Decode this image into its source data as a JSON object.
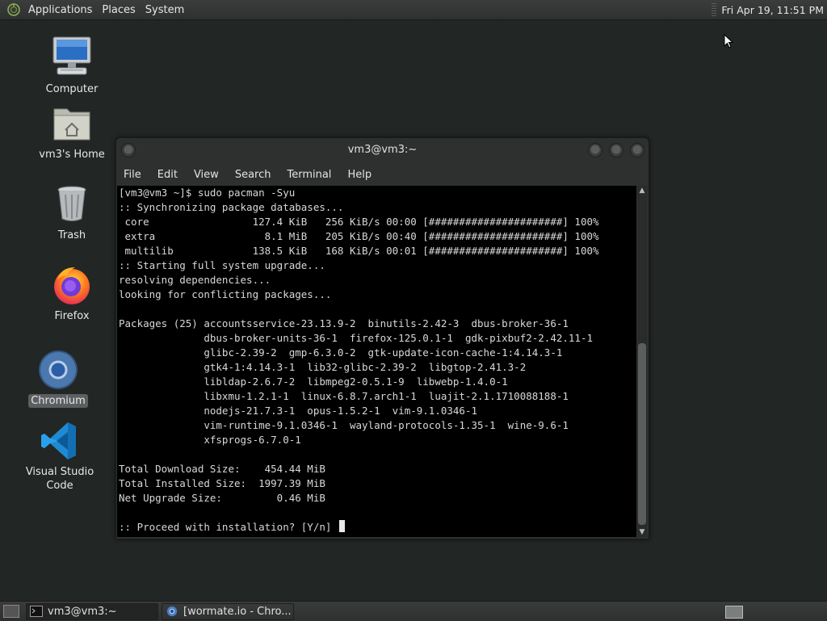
{
  "top_panel": {
    "menus": [
      "Applications",
      "Places",
      "System"
    ],
    "clock": "Fri Apr 19, 11:51 PM"
  },
  "desktop": {
    "icons": [
      {
        "label": "Computer",
        "icon": "computer-icon"
      },
      {
        "label": "vm3's Home",
        "icon": "home-folder-icon"
      },
      {
        "label": "Trash",
        "icon": "trash-icon"
      },
      {
        "label": "Firefox",
        "icon": "firefox-icon"
      },
      {
        "label": "Chromium",
        "icon": "chromium-icon",
        "selected": true
      },
      {
        "label": "Visual Studio Code",
        "icon": "vscode-icon"
      }
    ]
  },
  "terminal": {
    "title": "vm3@vm3:~",
    "menu": [
      "File",
      "Edit",
      "View",
      "Search",
      "Terminal",
      "Help"
    ],
    "lines": [
      "[vm3@vm3 ~]$ sudo pacman -Syu",
      ":: Synchronizing package databases...",
      " core                 127.4 KiB   256 KiB/s 00:00 [######################] 100%",
      " extra                  8.1 MiB   205 KiB/s 00:40 [######################] 100%",
      " multilib             138.5 KiB   168 KiB/s 00:01 [######################] 100%",
      ":: Starting full system upgrade...",
      "resolving dependencies...",
      "looking for conflicting packages...",
      "",
      "Packages (25) accountsservice-23.13.9-2  binutils-2.42-3  dbus-broker-36-1",
      "              dbus-broker-units-36-1  firefox-125.0.1-1  gdk-pixbuf2-2.42.11-1",
      "              glibc-2.39-2  gmp-6.3.0-2  gtk-update-icon-cache-1:4.14.3-1",
      "              gtk4-1:4.14.3-1  lib32-glibc-2.39-2  libgtop-2.41.3-2",
      "              libldap-2.6.7-2  libmpeg2-0.5.1-9  libwebp-1.4.0-1",
      "              libxmu-1.2.1-1  linux-6.8.7.arch1-1  luajit-2.1.1710088188-1",
      "              nodejs-21.7.3-1  opus-1.5.2-1  vim-9.1.0346-1",
      "              vim-runtime-9.1.0346-1  wayland-protocols-1.35-1  wine-9.6-1",
      "              xfsprogs-6.7.0-1",
      "",
      "Total Download Size:    454.44 MiB",
      "Total Installed Size:  1997.39 MiB",
      "Net Upgrade Size:         0.46 MiB",
      ""
    ],
    "prompt": ":: Proceed with installation? [Y/n] "
  },
  "taskbar": {
    "tasks": [
      {
        "label": "vm3@vm3:~",
        "icon": "terminal-icon",
        "active": true
      },
      {
        "label": "[wormate.io - Chro...",
        "icon": "chromium-icon",
        "active": false
      }
    ]
  }
}
